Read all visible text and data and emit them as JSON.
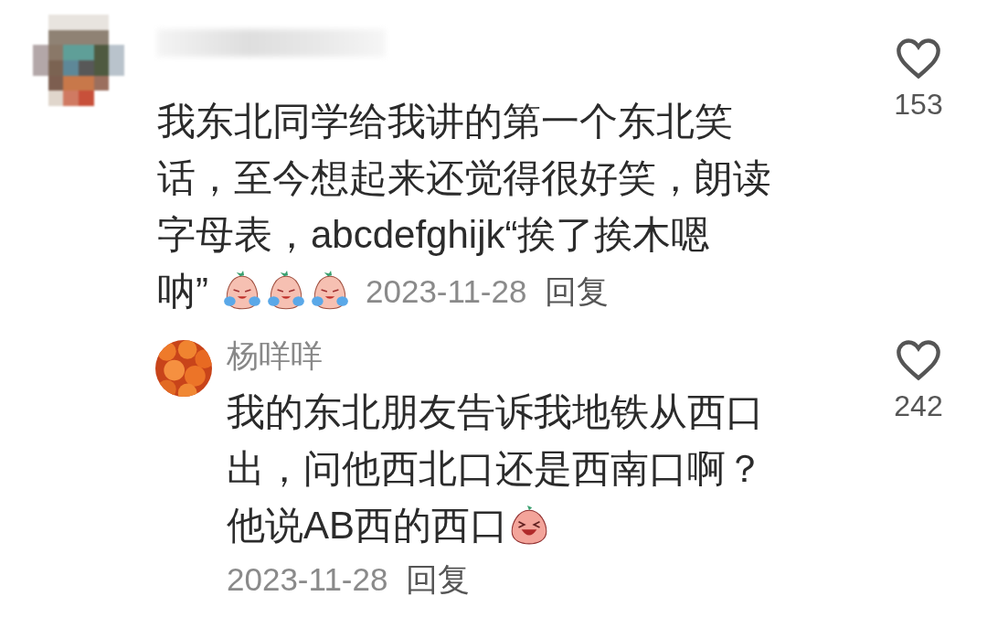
{
  "comments": [
    {
      "lines": [
        "我东北同学给我讲的第一个东北笑",
        "话，至今想起来还觉得很好笑，朗读",
        "字母表，abcdefghijk“挨了挨木嗯",
        "呐”"
      ],
      "emojis": [
        {
          "kind": "crying"
        },
        {
          "kind": "crying"
        },
        {
          "kind": "crying"
        }
      ],
      "date": "2023-11-28",
      "reply": "回复",
      "likes": "153",
      "liked": false,
      "replies": [
        {
          "author": "杨咩咩",
          "lines": [
            "我的东北朋友告诉我地铁从西口",
            "出，问他西北口还是西南口啊？",
            "他说AB西的西口"
          ],
          "emojis": [
            {
              "kind": "laughing"
            }
          ],
          "date": "2023-11-28",
          "reply": "回复",
          "likes": "242",
          "liked": false
        }
      ]
    }
  ]
}
